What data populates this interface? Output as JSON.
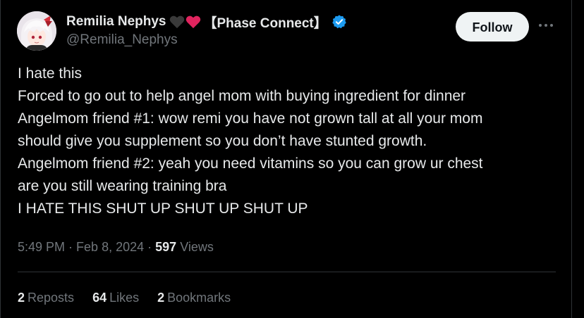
{
  "author": {
    "display_name": "Remilia Nephys",
    "affiliation": "【Phase Connect】",
    "handle": "@Remilia_Nephys",
    "avatar_icon": "anime-avatar",
    "badges": [
      "black-heart-icon",
      "red-heart-icon",
      "verified-badge-icon"
    ],
    "heart_colors": [
      "#3a3a3a",
      "#e0245e"
    ],
    "verified_color": "#1d9bf0"
  },
  "actions": {
    "follow_label": "Follow",
    "more_icon": "more-horizontal-icon"
  },
  "tweet": {
    "lines": [
      "I hate this",
      "Forced to go out to help angel mom with buying ingredient for dinner",
      "Angelmom friend #1: wow remi you have not grown tall at all your mom",
      "should give you supplement so you don’t have stunted growth.",
      "Angelmom friend #2: yeah you need vitamins so you can grow ur chest",
      "are you still wearing training bra",
      "I HATE THIS SHUT UP SHUT UP SHUT UP"
    ]
  },
  "meta": {
    "time": "5:49 PM",
    "separator": " · ",
    "date": "Feb 8, 2024",
    "views_count": "597",
    "views_label": "Views"
  },
  "stats": {
    "reposts_count": "2",
    "reposts_label": "Reposts",
    "likes_count": "64",
    "likes_label": "Likes",
    "bookmarks_count": "2",
    "bookmarks_label": "Bookmarks"
  },
  "colors": {
    "background": "#000000",
    "primary_text": "#e7e9ea",
    "secondary_text": "#71767b",
    "divider": "#2f3336",
    "follow_button_bg": "#eff3f4"
  }
}
